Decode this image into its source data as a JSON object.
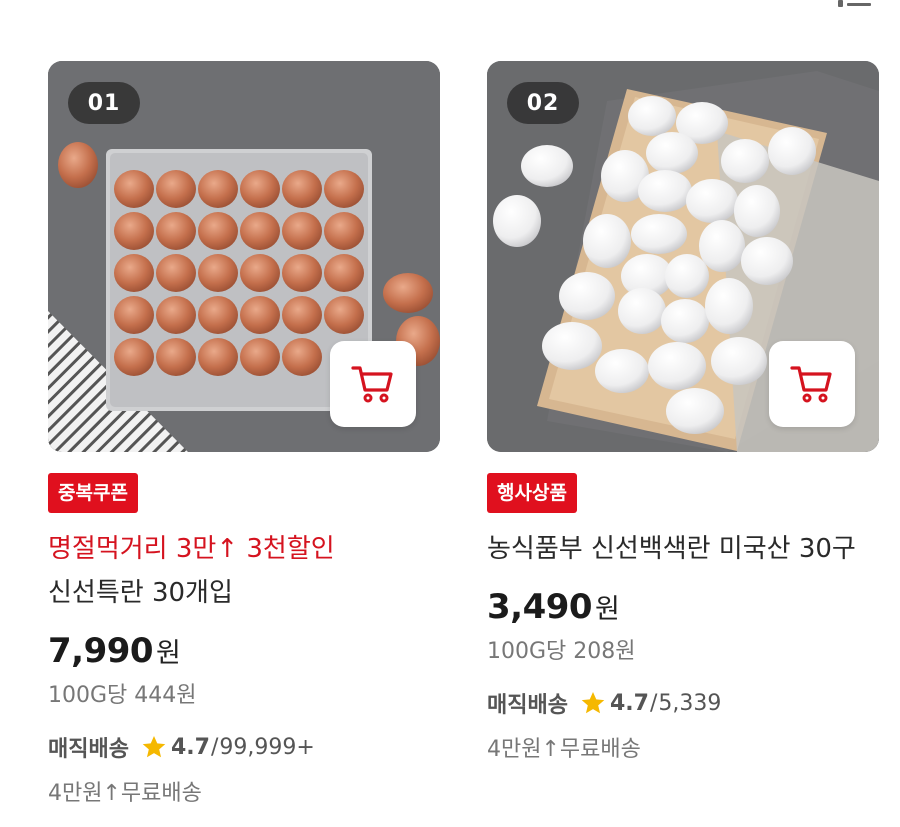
{
  "products": [
    {
      "rank": "01",
      "badge": "중복쿠폰",
      "promo": "명절먹거리 3만↑ 3천할인",
      "name": "신선특란 30개입",
      "price": "7,990",
      "currency": "원",
      "unit_price": "100G당 444원",
      "delivery": "매직배송",
      "rating": "4.7",
      "review_count": "99,999+",
      "shipping": "4만원↑무료배송",
      "image": "brown-eggs-tray-photo"
    },
    {
      "rank": "02",
      "badge": "행사상품",
      "promo": "",
      "name": "농식품부 신선백색란 미국산 30구",
      "price": "3,490",
      "currency": "원",
      "unit_price": "100G당 208원",
      "delivery": "매직배송",
      "rating": "4.7",
      "review_count": "5,339",
      "shipping": "4만원↑무료배송",
      "image": "white-eggs-board-photo"
    }
  ],
  "colors": {
    "accent": "#e0101e",
    "star": "#f5b800"
  },
  "icons": {
    "cart": "cart-icon",
    "star": "star-icon",
    "menu": "list-icon"
  }
}
